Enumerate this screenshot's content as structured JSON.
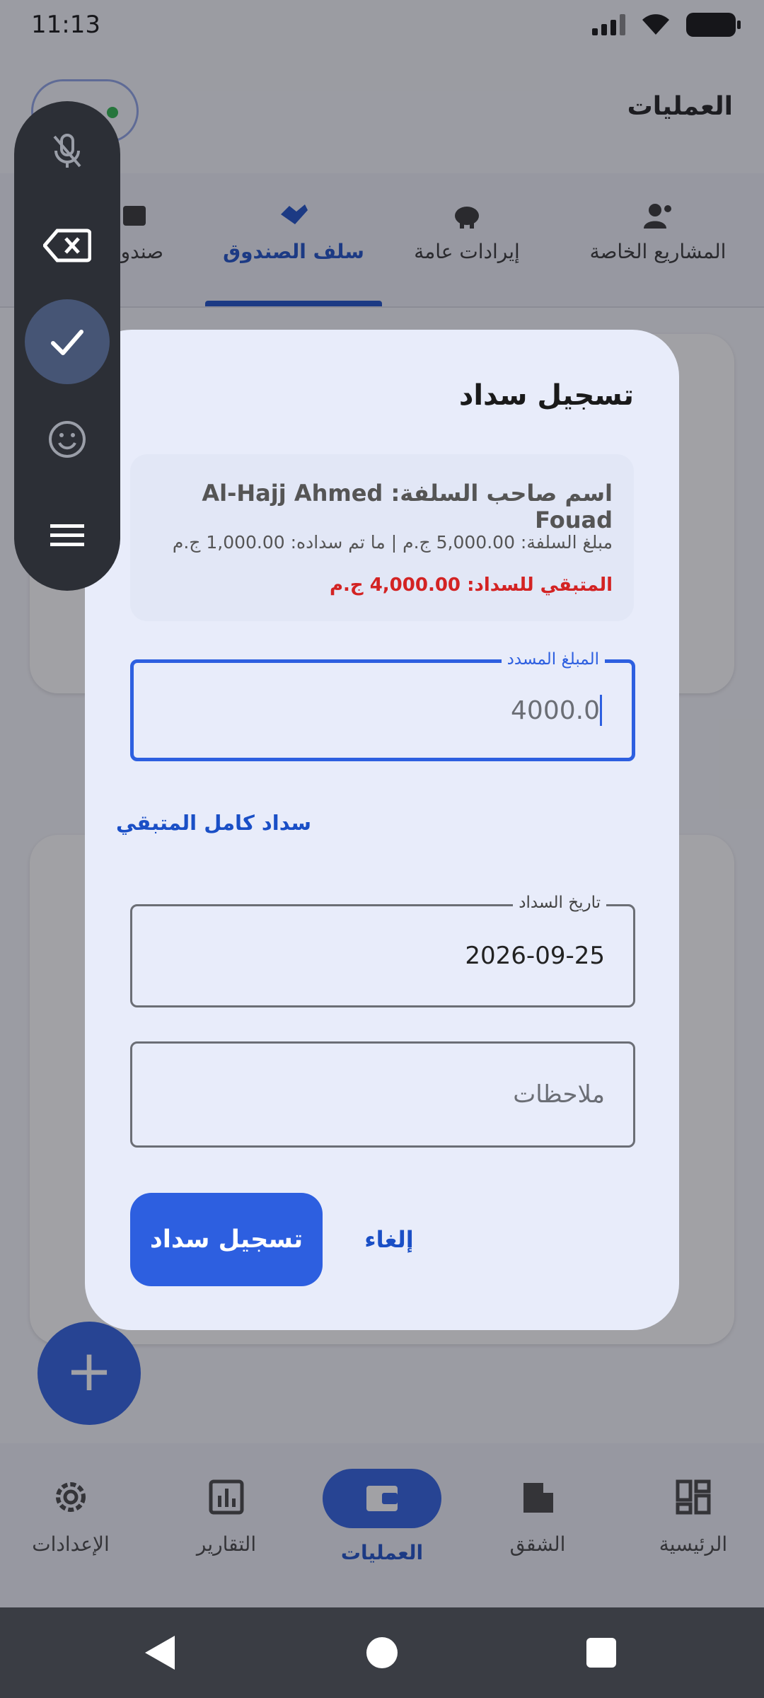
{
  "status_bar": {
    "time": "11:13"
  },
  "header": {
    "title": "العمليات"
  },
  "tabs": [
    {
      "label": "المشاريع الخاصة",
      "icon": "user-group-icon"
    },
    {
      "label": "إيرادات عامة",
      "icon": "piggy-bank-icon"
    },
    {
      "label": "سلف الصندوق",
      "icon": "handshake-icon",
      "active": true
    },
    {
      "label": "صندوق",
      "icon": "box-icon"
    }
  ],
  "dialog": {
    "title": "تسجيل سداد",
    "info": {
      "name_label": "اسم صاحب السلفة:",
      "name_value": "Al-Hajj Ahmed Fouad",
      "amounts": "مبلغ السلفة: 5,000.00 ج.م | ما تم سداده: 1,000.00 ج.م",
      "remaining_label": "المتبقي للسداد:",
      "remaining_value": "4,000.00 ج.م"
    },
    "amount_field": {
      "label": "المبلغ المسدد",
      "value": "4000.0"
    },
    "pay_full_label": "سداد كامل المتبقي",
    "date_field": {
      "label": "تاريخ السداد",
      "value": "2026-09-25"
    },
    "notes_field": {
      "placeholder": "ملاحظات"
    },
    "submit_label": "تسجيل سداد",
    "cancel_label": "إلغاء"
  },
  "bottom_nav": [
    {
      "label": "الرئيسية",
      "icon": "dashboard-icon"
    },
    {
      "label": "الشقق",
      "icon": "building-icon"
    },
    {
      "label": "العمليات",
      "icon": "wallet-icon",
      "active": true
    },
    {
      "label": "التقارير",
      "icon": "chart-icon"
    },
    {
      "label": "الإعدادات",
      "icon": "gear-icon"
    }
  ],
  "fab": {
    "label": "+"
  },
  "colors": {
    "primary": "#2d5fe0",
    "accent_text": "#1a4fc6",
    "danger": "#d32323",
    "dialog_bg": "#e8ecfa"
  }
}
